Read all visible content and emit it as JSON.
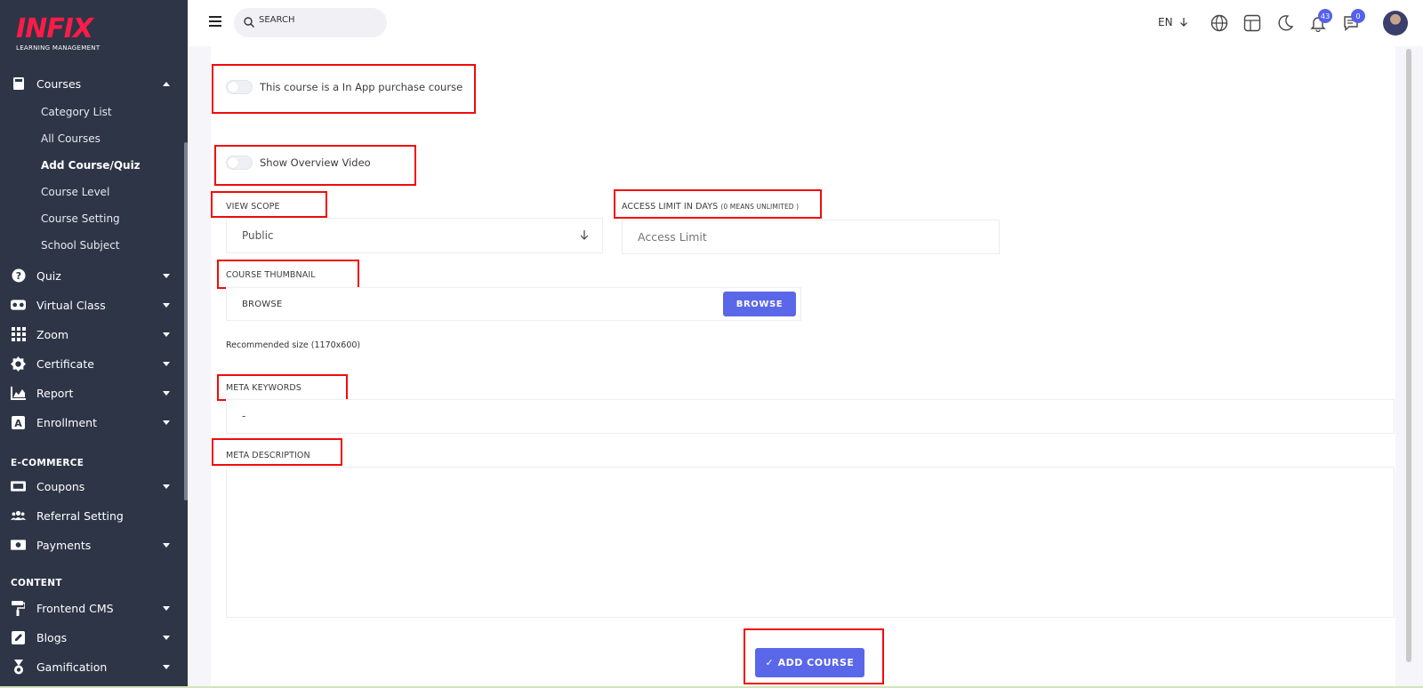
{
  "sidebar": {
    "logo": {
      "text": "INFIX",
      "subtitle": "LEARNING MANAGEMENT"
    },
    "courses": {
      "label": "Courses",
      "icon": "book-icon"
    },
    "courses_sub": [
      "Category List",
      "All Courses",
      "Add Course/Quiz",
      "Course Level",
      "Course Setting",
      "School Subject"
    ],
    "items": [
      {
        "label": "Quiz",
        "icon": "question-icon"
      },
      {
        "label": "Virtual Class",
        "icon": "vr-icon"
      },
      {
        "label": "Zoom",
        "icon": "grid-icon"
      },
      {
        "label": "Certificate",
        "icon": "certificate-icon"
      },
      {
        "label": "Report",
        "icon": "chart-icon"
      },
      {
        "label": "Enrollment",
        "icon": "enrollment-icon"
      }
    ],
    "section_ecommerce": "E-COMMERCE",
    "ecommerce_items": [
      {
        "label": "Coupons",
        "icon": "coupon-icon"
      },
      {
        "label": "Referral Setting",
        "icon": "users-icon"
      },
      {
        "label": "Payments",
        "icon": "money-icon"
      }
    ],
    "section_content": "CONTENT",
    "content_items": [
      {
        "label": "Frontend CMS",
        "icon": "paint-roller-icon"
      },
      {
        "label": "Blogs",
        "icon": "edit-icon"
      },
      {
        "label": "Gamification",
        "icon": "medal-icon"
      }
    ]
  },
  "topbar": {
    "search_placeholder": "SEARCH",
    "language": "EN",
    "notifications_count": "43",
    "messages_count": "0"
  },
  "form": {
    "in_app_purchase_label": "This course is a In App purchase course",
    "overview_video_label": "Show Overview Video",
    "view_scope_label": "VIEW SCOPE",
    "view_scope_value": "Public",
    "access_limit_label": "ACCESS LIMIT IN DAYS",
    "access_limit_hint": "(0 MEANS UNLIMITED )",
    "access_limit_placeholder": "Access Limit",
    "thumbnail_label": "COURSE THUMBNAIL",
    "thumbnail_placeholder": "BROWSE",
    "browse_button": "BROWSE",
    "recommended_size": "Recommended size (1170x600)",
    "meta_keywords_label": "META KEYWORDS",
    "meta_keywords_value": "-",
    "meta_description_label": "META DESCRIPTION",
    "meta_description_value": "",
    "add_course_button": "✓ ADD COURSE"
  },
  "colors": {
    "sidebar_bg": "#2e3547",
    "accent": "#5a67e9",
    "logo": "#fb1c48",
    "highlight": "#f20a0a"
  }
}
